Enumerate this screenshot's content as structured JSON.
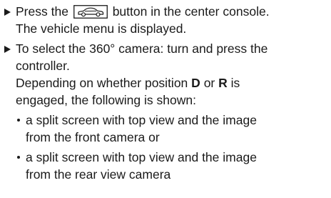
{
  "steps": [
    {
      "action_before_icon": "Press the",
      "icon": "vehicle-menu-car-icon",
      "action_after_icon": "button in the center console.",
      "result": "The vehicle menu is displayed."
    },
    {
      "action_line1": "To select the 360° camera: turn and press the",
      "action_line2": "controller.",
      "result_line1_before_d": "Depending on whether position",
      "result_d": "D",
      "result_or": "or",
      "result_r": "R",
      "result_is": "is",
      "result_line2": "engaged, the following is shown:",
      "bullets": [
        {
          "line1": "a split screen with top view and the image",
          "line2": "from the front camera or"
        },
        {
          "line1": "a split screen with top view and the image",
          "line2": "from the rear view camera"
        }
      ]
    }
  ]
}
